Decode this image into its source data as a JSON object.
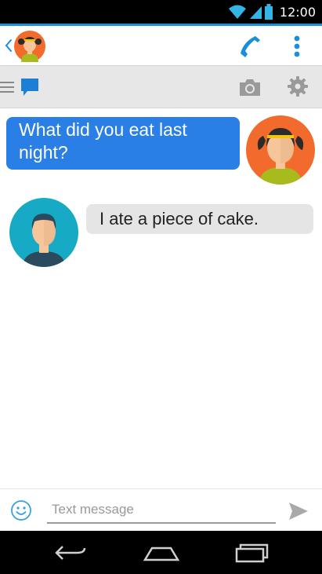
{
  "status_bar": {
    "time": "12:00",
    "icons": [
      "wifi-icon",
      "cellular-signal-icon",
      "battery-icon"
    ]
  },
  "app_bar": {
    "icons": [
      "back-chevron-icon",
      "contact-avatar",
      "phone-icon",
      "overflow-menu-icon"
    ]
  },
  "toolbar": {
    "icons": [
      "hamburger-menu-icon",
      "chat-bubble-icon",
      "camera-icon",
      "gear-icon"
    ]
  },
  "messages": [
    {
      "direction": "outgoing",
      "text": "What did you eat last night?",
      "avatar": "girl-avatar"
    },
    {
      "direction": "incoming",
      "text": "I ate a piece of cake.",
      "avatar": "boy-avatar"
    }
  ],
  "composer": {
    "placeholder": "Text message",
    "value": "",
    "icons": [
      "smiley-icon",
      "send-icon"
    ]
  },
  "nav_bar": {
    "icons": [
      "nav-back-icon",
      "nav-home-icon",
      "nav-recents-icon"
    ]
  },
  "colors": {
    "accent": "#1c8ed9",
    "outgoing_bubble": "#2a7fe6",
    "incoming_bubble": "#e5e5e5",
    "toolbar_bg": "#e7e7e7",
    "avatar_girl_bg": "#f26a2c",
    "avatar_boy_bg": "#17aac4"
  }
}
